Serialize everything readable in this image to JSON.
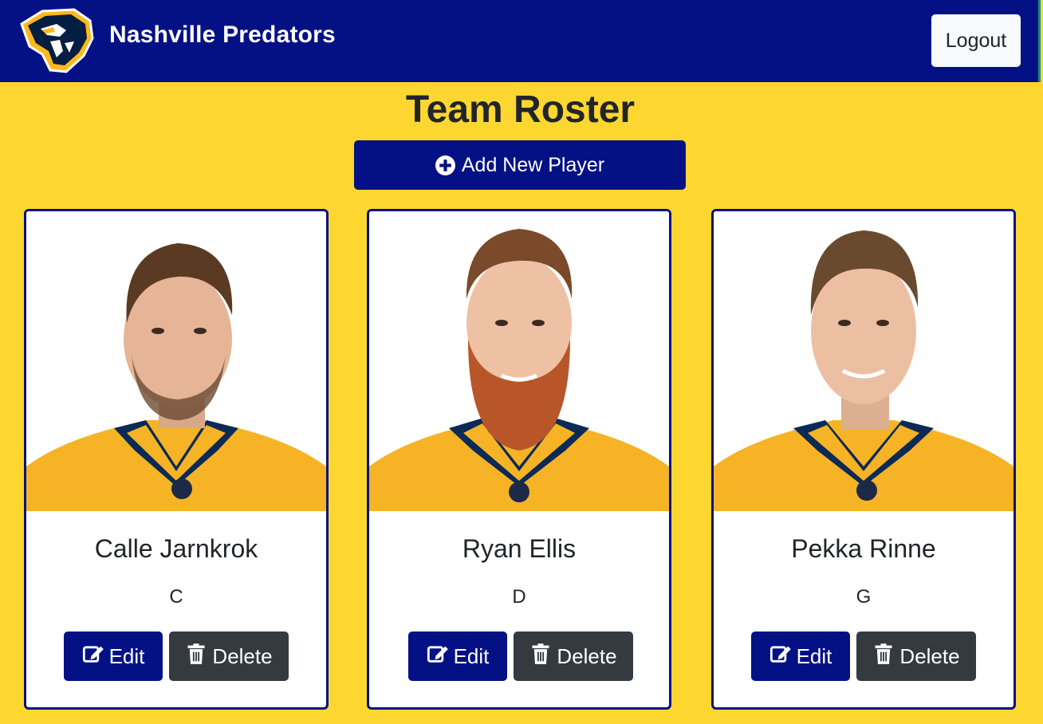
{
  "navbar": {
    "brand_name": "Nashville Predators",
    "logo_icon": "predators-logo",
    "logout_label": "Logout"
  },
  "page": {
    "title": "Team Roster",
    "add_button_label": "Add New Player",
    "add_button_icon": "plus-circle-icon"
  },
  "players": [
    {
      "name": "Calle Jarnkrok",
      "position": "C",
      "edit_label": "Edit",
      "delete_label": "Delete"
    },
    {
      "name": "Ryan Ellis",
      "position": "D",
      "edit_label": "Edit",
      "delete_label": "Delete"
    },
    {
      "name": "Pekka Rinne",
      "position": "G",
      "edit_label": "Edit",
      "delete_label": "Delete"
    }
  ],
  "colors": {
    "background": "#fdd630",
    "navbar": "#041185",
    "primary_button": "#041185",
    "delete_button": "#343a40",
    "card_border": "#041185"
  }
}
